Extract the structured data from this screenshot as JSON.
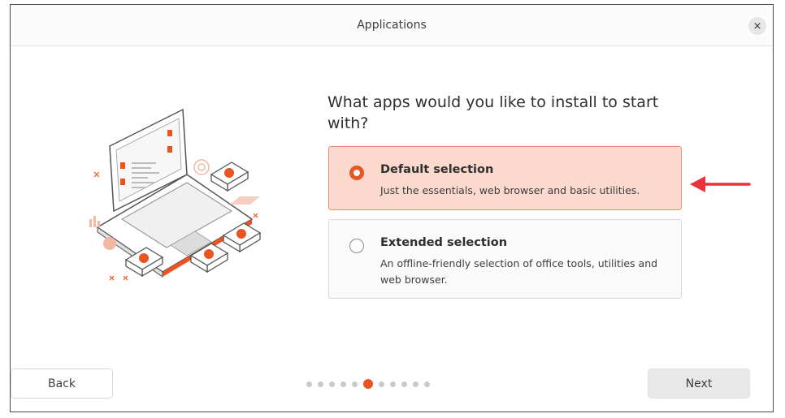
{
  "window": {
    "title": "Applications",
    "close_glyph": "×"
  },
  "question": "What apps would you like to install to start with?",
  "options": [
    {
      "title": "Default selection",
      "description": "Just the essentials, web browser and basic utilities.",
      "selected": true
    },
    {
      "title": "Extended selection",
      "description": "An offline-friendly selection of office tools, utilities and web browser.",
      "selected": false
    }
  ],
  "buttons": {
    "back": "Back",
    "next": "Next"
  },
  "pager": {
    "total": 11,
    "current": 6
  },
  "colors": {
    "accent": "#e95420",
    "selected_bg": "#fbd9cd",
    "arrow": "#e8333c"
  },
  "icons": {
    "close": "close-icon",
    "arrow": "red-arrow-annotation"
  }
}
